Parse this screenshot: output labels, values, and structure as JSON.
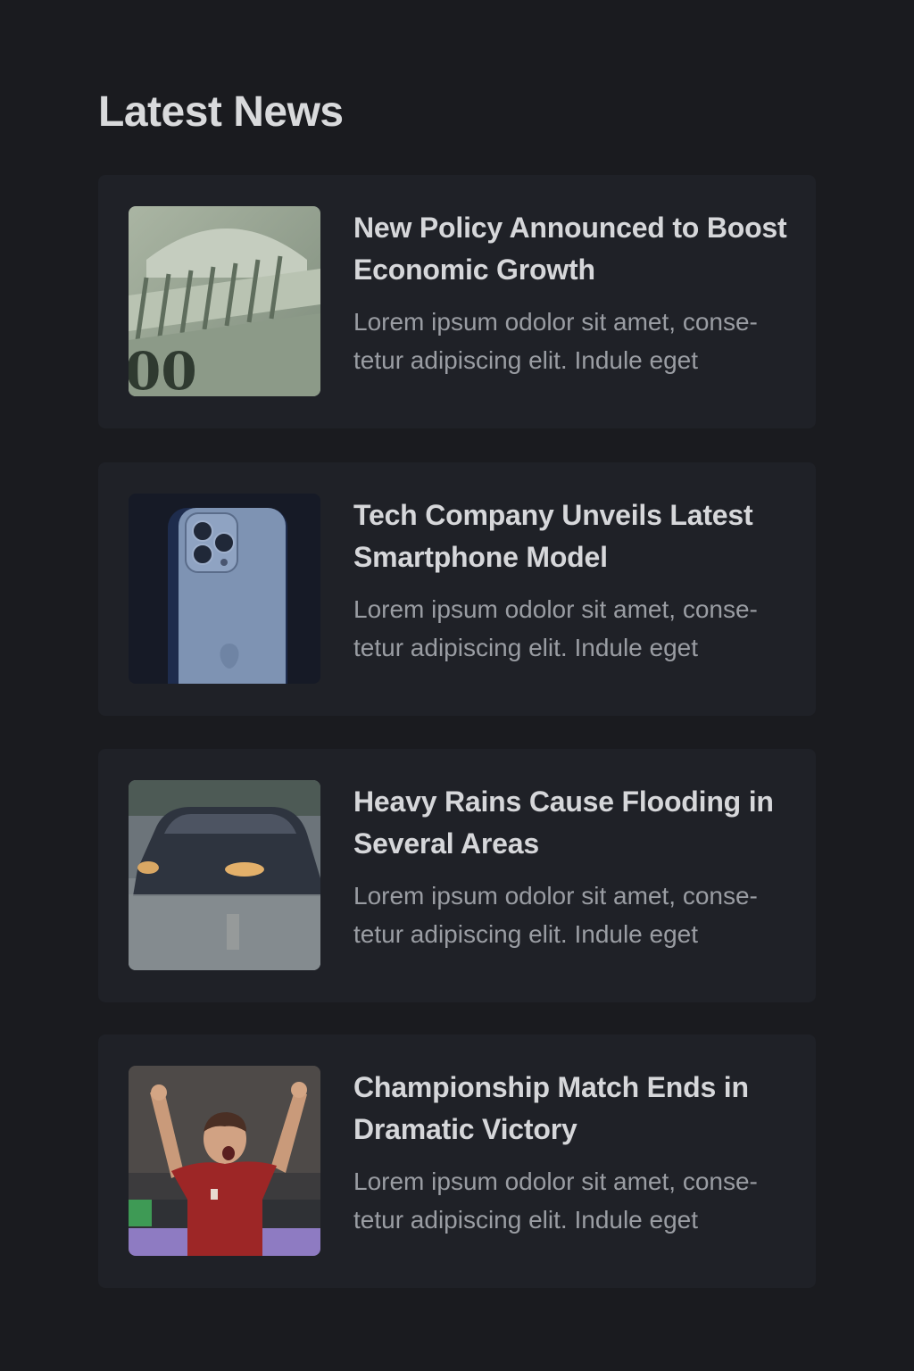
{
  "page": {
    "title": "Latest News"
  },
  "articles": [
    {
      "headline": "New Policy Announced to Boost Economic Growth",
      "excerpt": "Lorem ipsum odolor sit amet, conse-tetur adipiscing elit. Indule eget",
      "image": "capitol-banknote-image"
    },
    {
      "headline": "Tech Company Unveils Latest Smartphone Model",
      "excerpt": "Lorem ipsum odolor sit amet, conse-tetur adipiscing elit. Indule eget",
      "image": "smartphone-image"
    },
    {
      "headline": "Heavy Rains Cause Flooding in Several Areas",
      "excerpt": "Lorem ipsum odolor sit amet, conse-tetur adipiscing elit. Indule eget",
      "image": "flooded-car-image"
    },
    {
      "headline": "Championship Match Ends in Dramatic Victory",
      "excerpt": "Lorem ipsum odolor sit amet, conse-tetur adipiscing elit. Indule eget",
      "image": "celebrating-player-image"
    }
  ],
  "colors": {
    "background": "#1a1b1f",
    "card": "#1f2127",
    "headline": "#d6d7da",
    "excerpt": "#9a9da3"
  }
}
